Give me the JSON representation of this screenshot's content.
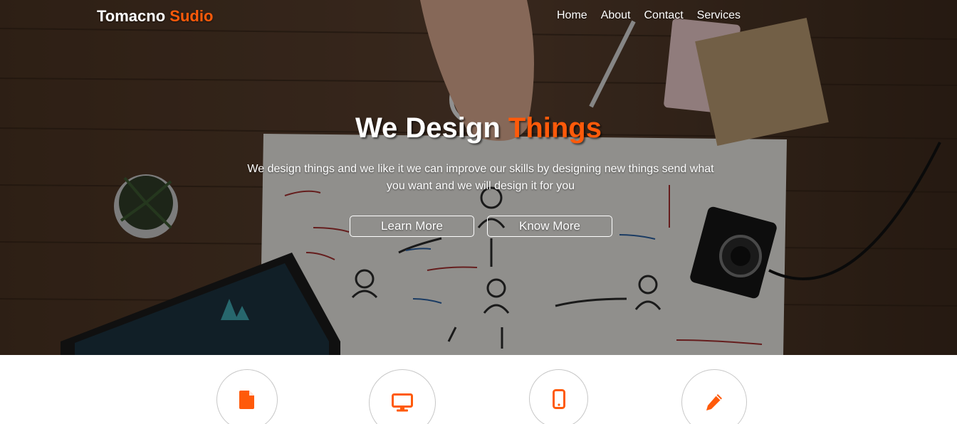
{
  "brand": {
    "name": "Tomacno",
    "accent": "Sudio"
  },
  "nav": [
    {
      "label": "Home"
    },
    {
      "label": "About"
    },
    {
      "label": "Contact"
    },
    {
      "label": "Services"
    }
  ],
  "hero": {
    "title_main": "We Design",
    "title_accent": "Things",
    "text": "We design things and we like it we can improve our skills by designing new things send what you want and we will design it for you",
    "buttons": {
      "learn_more": "Learn More",
      "know_more": "Know More"
    }
  },
  "services": {
    "icons": [
      "document-icon",
      "monitor-icon",
      "mobile-phone-icon",
      "pencil-icon"
    ]
  },
  "colors": {
    "accent": "#ff5a0a",
    "text_light": "#ffffff",
    "circle_border": "#c7c7c7"
  }
}
